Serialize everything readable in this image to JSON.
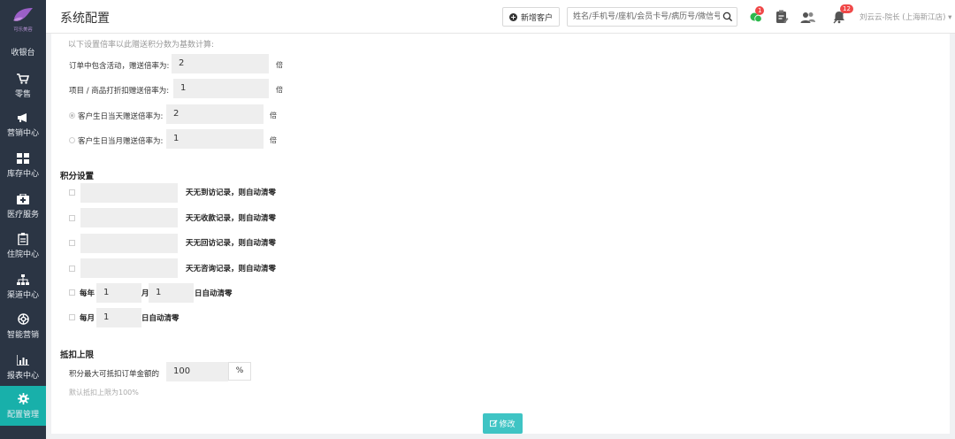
{
  "brand": {
    "text": "可乐美容"
  },
  "sidebar": {
    "items": [
      {
        "label": "收银台"
      },
      {
        "label": "零售"
      },
      {
        "label": "营销中心"
      },
      {
        "label": "库存中心"
      },
      {
        "label": "医疗服务"
      },
      {
        "label": "住院中心"
      },
      {
        "label": "渠道中心"
      },
      {
        "label": "智能营销"
      },
      {
        "label": "报表中心"
      },
      {
        "label": "配置管理"
      }
    ],
    "active_index": 9
  },
  "header": {
    "title": "系统配置",
    "new_customer_label": "新增客户",
    "search_placeholder": "姓名/手机号/座机/会员卡号/病历号/微信号",
    "badges": {
      "wechat": "1",
      "bell": "12"
    },
    "user_label": "刘云云-院长 (上海新江店) ▾"
  },
  "colors": {
    "accent": "#18b0aa",
    "sidebar_bg": "#2b3544",
    "badge": "#f04848",
    "button": "#3fc4c4"
  },
  "multiplier": {
    "intro": "以下设置倍率以此赠送积分数为基数计算:",
    "rows": [
      {
        "label": "订单中包含活动，赠送倍率为:",
        "value": "2",
        "unit": "倍"
      },
      {
        "label": "项目 / 商品打折扣赠送倍率为:",
        "value": "1",
        "unit": "倍"
      },
      {
        "label": "客户生日当天赠送倍率为:",
        "value": "2",
        "unit": "倍"
      },
      {
        "label": "客户生日当月赠送倍率为:",
        "value": "1",
        "unit": "倍"
      }
    ]
  },
  "points": {
    "title": "积分设置",
    "rows": [
      {
        "value": "",
        "label": "天无到访记录，则自动清零"
      },
      {
        "value": "",
        "label": "天无收款记录，则自动清零"
      },
      {
        "value": "",
        "label": "天无回访记录，则自动清零"
      },
      {
        "value": "",
        "label": "天无咨询记录，则自动清零"
      }
    ],
    "yearly": {
      "prefix": "每年",
      "month_value": "1",
      "month_label": "月",
      "day_value": "1",
      "day_label": "日自动清零"
    },
    "monthly": {
      "prefix": "每月",
      "day_value": "1",
      "day_label": "日自动清零"
    }
  },
  "deduct": {
    "title": "抵扣上限",
    "label": "积分最大可抵扣订单金额的",
    "value": "100",
    "unit": "%",
    "hint": "默认抵扣上限为100%"
  },
  "edit_button": {
    "label": "修改"
  }
}
